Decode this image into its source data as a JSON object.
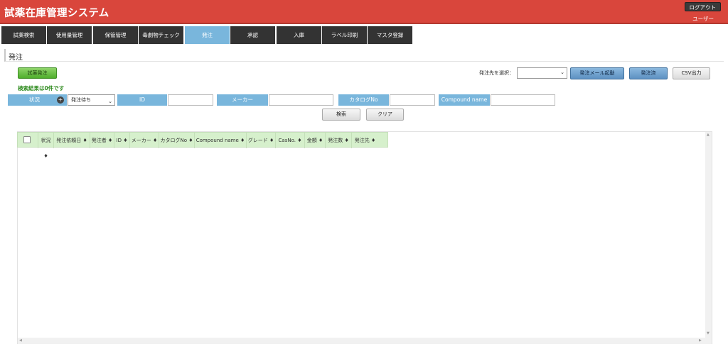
{
  "header": {
    "title": "試薬在庫管理システム",
    "logout_label": "ログアウト",
    "user_label": "ユーザー"
  },
  "tabs": [
    {
      "label": "試薬検索"
    },
    {
      "label": "使用量管理"
    },
    {
      "label": "保管管理"
    },
    {
      "label": "毒劇物チェック"
    },
    {
      "label": "発注",
      "active": true
    },
    {
      "label": "承認"
    },
    {
      "label": "入庫"
    },
    {
      "label": "ラベル印刷"
    },
    {
      "label": "マスタ登録"
    }
  ],
  "page": {
    "title": "発注"
  },
  "toolbar": {
    "trial_order_label": "試薬発注",
    "supplier_select_label": "発注先を選択：",
    "supplier_select_value": "",
    "mail_launch_label": "発注メール起動",
    "ordered_label": "発注済",
    "csv_label": "CSV出力"
  },
  "result_text": "検索結果は0件です",
  "filters": {
    "status_label": "状況",
    "status_value": "発注待ち",
    "id_label": "ID",
    "maker_label": "メーカー",
    "catalog_label": "カタログNo",
    "compound_label": "Compound name",
    "search_label": "検索",
    "clear_label": "クリア"
  },
  "table": {
    "columns": [
      "状況",
      "発注依頼日",
      "発注者",
      "ID",
      "メーカー",
      "カタログNo",
      "Compound name",
      "グレード",
      "CasNo.",
      "金額",
      "発注数",
      "発注先"
    ],
    "rows": []
  },
  "colors": {
    "header_bg": "#d9463c",
    "tab_bg": "#333333",
    "tab_active_bg": "#79b6dc",
    "filter_label_bg": "#79b6dc",
    "table_header_bg": "#d6f0cc",
    "result_text": "#2e8b1e"
  },
  "icons": {
    "status_add": "plus-circle-icon",
    "select_caret": "chevron-down-icon",
    "sort": "sort-icon"
  }
}
